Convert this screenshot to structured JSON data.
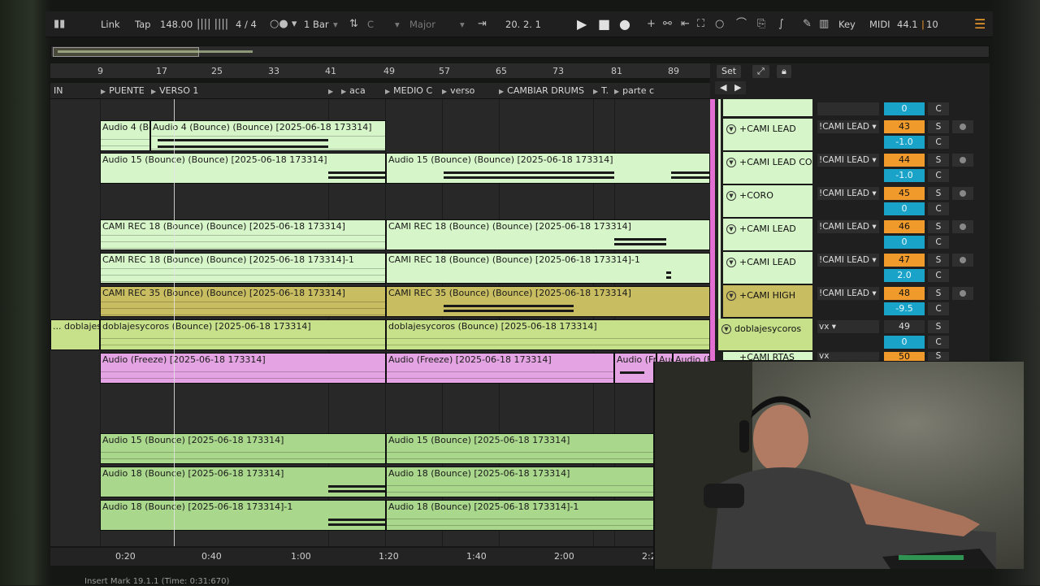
{
  "transport": {
    "link": "Link",
    "tap": "Tap",
    "tempo": "148.00",
    "time_signature": "4 / 4",
    "quantize": "1 Bar",
    "key_root": "C",
    "scale": "Major",
    "position": "20.  2.  1",
    "key_button": "Key",
    "midi_button": "MIDI",
    "sample_rate": "44.1",
    "cpu": "10"
  },
  "ruler": {
    "bars": [
      "9",
      "17",
      "25",
      "33",
      "41",
      "49",
      "57",
      "65",
      "73",
      "81",
      "89"
    ]
  },
  "locators": [
    "IN",
    "PUENTE",
    "VERSO 1",
    "aca",
    "MEDIO C",
    "verso",
    "CAMBIAR DRUMS",
    "T.",
    "parte c"
  ],
  "clips": {
    "lane1": [
      "Audio 4 (Bo",
      "Audio 4 (Bounce) (Bounce) [2025-06-18 173314]"
    ],
    "lane2": [
      "Audio 15 (Bounce) (Bounce) [2025-06-18 173314]",
      "Audio 15 (Bounce) (Bounce) [2025-06-18 173314]"
    ],
    "lane3": [
      "CAMI REC 18 (Bounce) (Bounce) [2025-06-18 173314]",
      "CAMI REC 18 (Bounce) (Bounce) [2025-06-18 173314]"
    ],
    "lane4": [
      "CAMI REC 18 (Bounce) (Bounce) [2025-06-18 173314]-1",
      "CAMI REC 18 (Bounce) (Bounce) [2025-06-18 173314]-1"
    ],
    "lane5": [
      "CAMI REC 35 (Bounce) (Bounce) [2025-06-18 173314]",
      "CAMI REC 35 (Bounce) (Bounce) [2025-06-18 173314]"
    ],
    "lane6": [
      "... doblajes",
      "doblajesycoros (Bounce) [2025-06-18 173314]",
      "doblajesycoros (Bounce) [2025-06-18 173314]"
    ],
    "lane7": [
      "Audio (Freeze) [2025-06-18 173314]",
      "Audio (Freeze) [2025-06-18 173314]",
      "Audio (Fr",
      "Aud",
      "Audio (F"
    ],
    "lane8": [
      "Audio 15 (Bounce) [2025-06-18 173314]",
      "Audio 15 (Bounce) [2025-06-18 173314]"
    ],
    "lane9": [
      "Audio 18 (Bounce) [2025-06-18 173314]",
      "Audio 18 (Bounce) [2025-06-18 173314]"
    ],
    "lane10": [
      "Audio 18 (Bounce) [2025-06-18 173314]-1",
      "Audio 18 (Bounce) [2025-06-18 173314]-1"
    ]
  },
  "mixer": {
    "set_label": "Set",
    "tracks": [
      {
        "name": "",
        "input": "",
        "number": "0",
        "pan": "C",
        "num_style": "blue"
      },
      {
        "name": "+CAMI LEAD",
        "input": "!CAMI LEAD",
        "number": "43",
        "volume": "-1.0",
        "pan": "C",
        "solo": "S"
      },
      {
        "name": "+CAMI LEAD CO",
        "input": "!CAMI LEAD",
        "number": "44",
        "volume": "-1.0",
        "pan": "C",
        "solo": "S"
      },
      {
        "name": "+CORO",
        "input": "!CAMI LEAD",
        "number": "45",
        "volume": "0",
        "pan": "C",
        "solo": "S"
      },
      {
        "name": "+CAMI LEAD",
        "input": "!CAMI LEAD",
        "number": "46",
        "volume": "0",
        "pan": "C",
        "solo": "S"
      },
      {
        "name": "+CAMI LEAD",
        "input": "!CAMI LEAD",
        "number": "47",
        "volume": "2.0",
        "pan": "C",
        "solo": "S"
      },
      {
        "name": "+CAMI HIGH",
        "input": "!CAMI LEAD",
        "number": "48",
        "volume": "-9.5",
        "pan": "C",
        "solo": "S"
      },
      {
        "name": "doblajesycoros",
        "input": "vx",
        "number": "49",
        "volume": "0",
        "pan": "C",
        "solo": "S"
      },
      {
        "name": "+CAMI RTAS",
        "input": "vx",
        "number": "50",
        "solo": "S"
      }
    ]
  },
  "time_ruler": [
    "0:20",
    "0:40",
    "1:00",
    "1:20",
    "1:40",
    "2:00",
    "2:2"
  ],
  "status_bar": "Insert Mark 19.1.1 (Time: 0:31:670)"
}
